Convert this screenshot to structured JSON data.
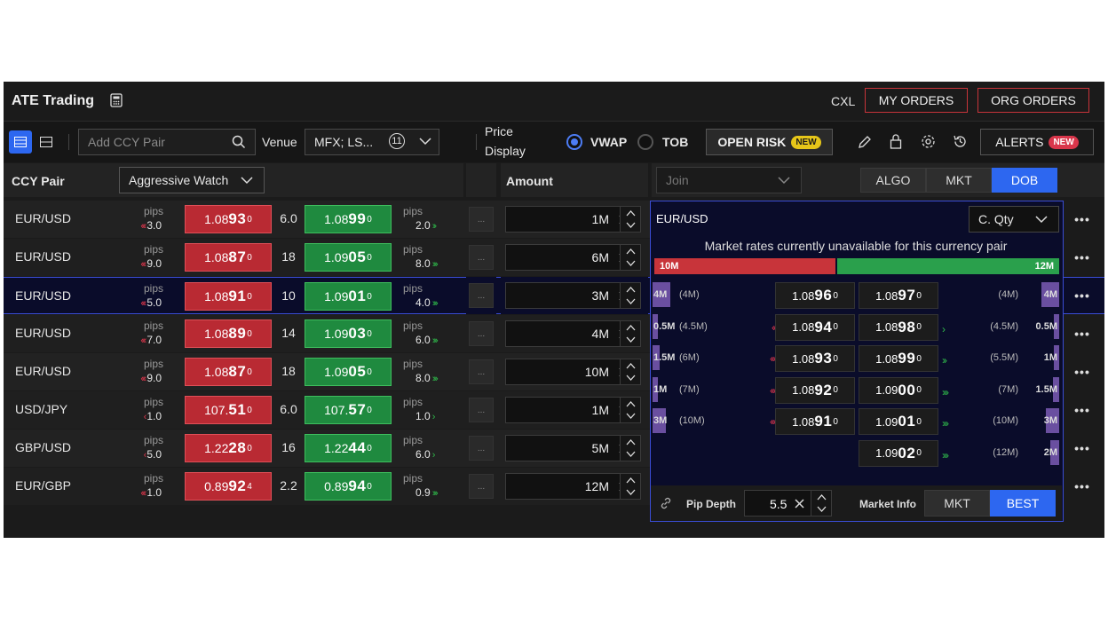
{
  "app": {
    "title": "ATE Trading",
    "cxl_label": "CXL",
    "my_orders_label": "MY ORDERS",
    "org_orders_label": "ORG ORDERS"
  },
  "toolbar": {
    "search_placeholder": "Add CCY Pair",
    "venue_label": "Venue",
    "venue_value": "MFX; LS...",
    "venue_count": "11",
    "price_display_label_1": "Price",
    "price_display_label_2": "Display",
    "vwap_label": "VWAP",
    "tob_label": "TOB",
    "open_risk_label": "OPEN RISK",
    "open_risk_badge": "NEW",
    "alerts_label": "ALERTS",
    "alerts_badge": "NEW"
  },
  "grid_header": {
    "ccy_pair": "CCY Pair",
    "watch_select": "Aggressive Watch",
    "amount": "Amount",
    "join_placeholder": "Join",
    "algo": "ALGO",
    "mkt": "MKT",
    "dob": "DOB"
  },
  "rows": [
    {
      "pair": "EUR/USD",
      "pips_label": "pips",
      "bid_arrows": "‹‹‹",
      "bid_pips": "3.0",
      "bid_pre": "1.08",
      "bid_big": "93",
      "bid_sup": "0",
      "spread": "6.0",
      "ask_pre": "1.08",
      "ask_big": "99",
      "ask_sup": "0",
      "ask_pips": "2.0",
      "ask_arrows": "››",
      "dots": "...",
      "amount": "1M"
    },
    {
      "pair": "EUR/USD",
      "pips_label": "pips",
      "bid_arrows": "‹‹‹",
      "bid_pips": "9.0",
      "bid_pre": "1.08",
      "bid_big": "87",
      "bid_sup": "0",
      "spread": "18",
      "ask_pre": "1.09",
      "ask_big": "05",
      "ask_sup": "0",
      "ask_pips": "8.0",
      "ask_arrows": "›››",
      "dots": "...",
      "amount": "6M"
    },
    {
      "pair": "EUR/USD",
      "pips_label": "pips",
      "bid_arrows": "‹‹‹",
      "bid_pips": "5.0",
      "bid_pre": "1.08",
      "bid_big": "91",
      "bid_sup": "0",
      "spread": "10",
      "ask_pre": "1.09",
      "ask_big": "01",
      "ask_sup": "0",
      "ask_pips": "4.0",
      "ask_arrows": "›››",
      "dots": "...",
      "amount": "3M"
    },
    {
      "pair": "EUR/USD",
      "pips_label": "pips",
      "bid_arrows": "‹‹‹",
      "bid_pips": "7.0",
      "bid_pre": "1.08",
      "bid_big": "89",
      "bid_sup": "0",
      "spread": "14",
      "ask_pre": "1.09",
      "ask_big": "03",
      "ask_sup": "0",
      "ask_pips": "6.0",
      "ask_arrows": "›››",
      "dots": "...",
      "amount": "4M"
    },
    {
      "pair": "EUR/USD",
      "pips_label": "pips",
      "bid_arrows": "‹‹‹",
      "bid_pips": "9.0",
      "bid_pre": "1.08",
      "bid_big": "87",
      "bid_sup": "0",
      "spread": "18",
      "ask_pre": "1.09",
      "ask_big": "05",
      "ask_sup": "0",
      "ask_pips": "8.0",
      "ask_arrows": "›››",
      "dots": "...",
      "amount": "10M"
    },
    {
      "pair": "USD/JPY",
      "pips_label": "pips",
      "bid_arrows": "‹",
      "bid_pips": "1.0",
      "bid_pre": "107.",
      "bid_big": "51",
      "bid_sup": "0",
      "spread": "6.0",
      "ask_pre": "107.",
      "ask_big": "57",
      "ask_sup": "0",
      "ask_pips": "1.0",
      "ask_arrows": "›",
      "dots": "...",
      "amount": "1M"
    },
    {
      "pair": "GBP/USD",
      "pips_label": "pips",
      "bid_arrows": "‹",
      "bid_pips": "5.0",
      "bid_pre": "1.22",
      "bid_big": "28",
      "bid_sup": "0",
      "spread": "16",
      "ask_pre": "1.22",
      "ask_big": "44",
      "ask_sup": "0",
      "ask_pips": "6.0",
      "ask_arrows": "›",
      "dots": "...",
      "amount": "5M"
    },
    {
      "pair": "EUR/GBP",
      "pips_label": "pips",
      "bid_arrows": "‹‹‹",
      "bid_pips": "1.0",
      "bid_pre": "0.89",
      "bid_big": "92",
      "bid_sup": "4",
      "spread": "2.2",
      "ask_pre": "0.89",
      "ask_big": "94",
      "ask_sup": "0",
      "ask_pips": "0.9",
      "ask_arrows": "›››",
      "dots": "...",
      "amount": "12M"
    }
  ],
  "dob": {
    "pair": "EUR/USD",
    "qty_select": "C. Qty",
    "message": "Market rates currently unavailable for this currency pair",
    "bid_total": "10M",
    "ask_total": "12M",
    "bid_fraction": 0.45,
    "levels": [
      {
        "bid_qty": "4M",
        "bid_paren": "(4M)",
        "bid_arrows": "",
        "bid_pre": "1.08",
        "bid_big": "96",
        "bid_sup": "0",
        "ask_pre": "1.08",
        "ask_big": "97",
        "ask_sup": "0",
        "ask_arrows": "",
        "ask_paren": "(4M)",
        "ask_qty": "4M"
      },
      {
        "bid_qty": "0.5M",
        "bid_paren": "(4.5M)",
        "bid_arrows": "‹‹",
        "bid_pre": "1.08",
        "bid_big": "94",
        "bid_sup": "0",
        "ask_pre": "1.08",
        "ask_big": "98",
        "ask_sup": "0",
        "ask_arrows": "›",
        "ask_paren": "(4.5M)",
        "ask_qty": "0.5M"
      },
      {
        "bid_qty": "1.5M",
        "bid_paren": "(6M)",
        "bid_arrows": "‹‹‹",
        "bid_pre": "1.08",
        "bid_big": "93",
        "bid_sup": "0",
        "ask_pre": "1.08",
        "ask_big": "99",
        "ask_sup": "0",
        "ask_arrows": "››",
        "ask_paren": "(5.5M)",
        "ask_qty": "1M"
      },
      {
        "bid_qty": "1M",
        "bid_paren": "(7M)",
        "bid_arrows": "‹‹‹",
        "bid_pre": "1.08",
        "bid_big": "92",
        "bid_sup": "0",
        "ask_pre": "1.09",
        "ask_big": "00",
        "ask_sup": "0",
        "ask_arrows": "›››",
        "ask_paren": "(7M)",
        "ask_qty": "1.5M"
      },
      {
        "bid_qty": "3M",
        "bid_paren": "(10M)",
        "bid_arrows": "‹‹‹",
        "bid_pre": "1.08",
        "bid_big": "91",
        "bid_sup": "0",
        "ask_pre": "1.09",
        "ask_big": "01",
        "ask_sup": "0",
        "ask_arrows": "›››",
        "ask_paren": "(10M)",
        "ask_qty": "3M"
      },
      {
        "bid_qty": "",
        "bid_paren": "",
        "bid_arrows": "",
        "bid_pre": "",
        "bid_big": "",
        "bid_sup": "",
        "ask_pre": "1.09",
        "ask_big": "02",
        "ask_sup": "0",
        "ask_arrows": "›››",
        "ask_paren": "(12M)",
        "ask_qty": "2M"
      }
    ],
    "pip_depth_label": "Pip Depth",
    "pip_depth_value": "5.5",
    "market_info_label": "Market Info",
    "mkt_label": "MKT",
    "best_label": "BEST"
  },
  "more_label": "•••",
  "colors": {
    "bid": "#b92a33",
    "ask": "#1f8a3f",
    "accent": "#2d67f0",
    "panel": "#0a0c2a"
  }
}
